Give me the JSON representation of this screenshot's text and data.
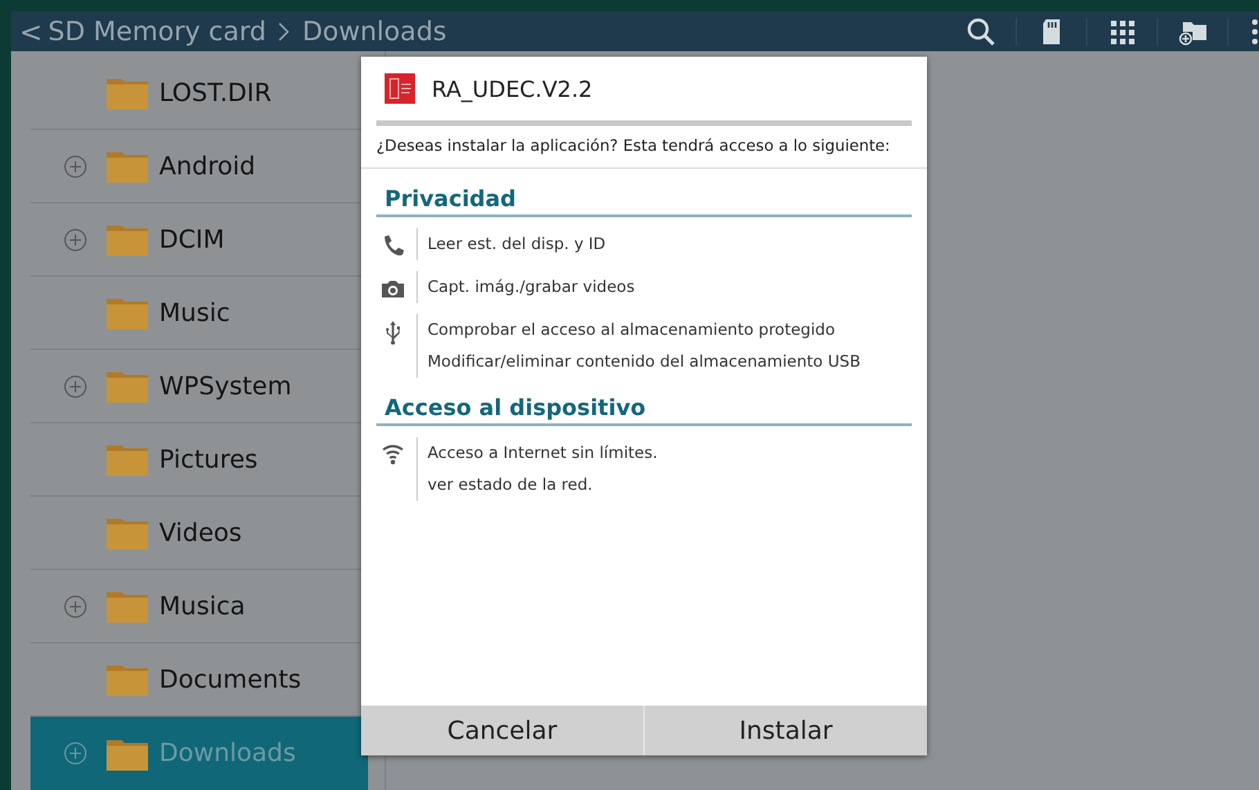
{
  "toolbar": {
    "back": "<",
    "breadcrumbs": [
      {
        "label": "SD Memory card"
      },
      {
        "label": "Downloads"
      }
    ]
  },
  "folders": [
    {
      "name": "LOST.DIR",
      "expandable": false,
      "selected": false
    },
    {
      "name": "Android",
      "expandable": true,
      "selected": false
    },
    {
      "name": "DCIM",
      "expandable": true,
      "selected": false
    },
    {
      "name": "Music",
      "expandable": false,
      "selected": false
    },
    {
      "name": "WPSystem",
      "expandable": true,
      "selected": false
    },
    {
      "name": "Pictures",
      "expandable": false,
      "selected": false
    },
    {
      "name": "Videos",
      "expandable": false,
      "selected": false
    },
    {
      "name": "Musica",
      "expandable": true,
      "selected": false
    },
    {
      "name": "Documents",
      "expandable": false,
      "selected": false
    },
    {
      "name": "Downloads",
      "expandable": true,
      "selected": true
    }
  ],
  "dialog": {
    "app_name": "RA_UDEC.V2.2",
    "question": "¿Deseas instalar la aplicación? Esta tendrá acceso a lo siguiente:",
    "sections": [
      {
        "title": "Privacidad",
        "groups": [
          {
            "kind": "phone",
            "permissions": [
              "Leer est. del disp. y ID"
            ]
          },
          {
            "kind": "camera",
            "permissions": [
              "Capt. imág./grabar videos"
            ]
          },
          {
            "kind": "usb",
            "permissions": [
              "Comprobar el acceso al almacenamiento protegido",
              "Modificar/eliminar contenido del almacenamiento USB"
            ]
          }
        ]
      },
      {
        "title": "Acceso al dispositivo",
        "groups": [
          {
            "kind": "wifi",
            "permissions": [
              "Acceso a Internet sin límites.",
              "ver estado de la red."
            ]
          }
        ]
      }
    ],
    "buttons": [
      {
        "label": "Cancelar"
      },
      {
        "label": "Instalar"
      }
    ]
  }
}
